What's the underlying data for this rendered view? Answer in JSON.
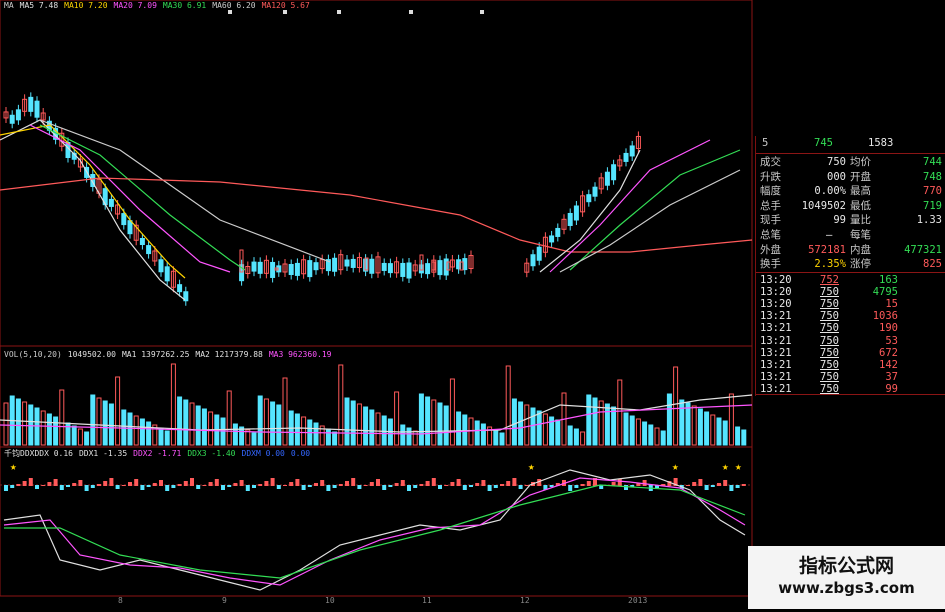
{
  "ma_legend": [
    {
      "text": "MA",
      "color": "#cccccc"
    },
    {
      "text": "MA5 7.48",
      "color": "#e0e0e0"
    },
    {
      "text": "MA10 7.20",
      "color": "#ffd400"
    },
    {
      "text": "MA20 7.09",
      "color": "#ff55ff"
    },
    {
      "text": "MA30 6.91",
      "color": "#33dd55"
    },
    {
      "text": "MA60 6.20",
      "color": "#cccccc"
    },
    {
      "text": "MA120 5.67",
      "color": "#ff5a5a"
    }
  ],
  "vol_legend": [
    {
      "text": "VOL(5,10,20)",
      "color": "#cccccc"
    },
    {
      "text": "1049502.00",
      "color": "#e0e0e0"
    },
    {
      "text": "MA1 1397262.25",
      "color": "#e0e0e0"
    },
    {
      "text": "MA2 1217379.88",
      "color": "#e0e0e0"
    },
    {
      "text": "MA3 962360.19",
      "color": "#ff55ff"
    }
  ],
  "ddx_legend": [
    {
      "text": "千钧DDXDDX 0.16",
      "color": "#e0e0e0"
    },
    {
      "text": "DDX1 -1.35",
      "color": "#e0e0e0"
    },
    {
      "text": "DDX2 -1.71",
      "color": "#ff55ff"
    },
    {
      "text": "DDX3 -1.40",
      "color": "#33dd55"
    },
    {
      "text": "DDXM 0.00",
      "color": "#3366ff"
    },
    {
      "text": "0.00",
      "color": "#3366ff"
    }
  ],
  "date_axis": [
    "8",
    "9",
    "10",
    "11",
    "12",
    "2013"
  ],
  "panel": {
    "header": {
      "label": "5",
      "v1": "745",
      "v2": "1583"
    },
    "stats": [
      {
        "k1": "成交",
        "v1": "750",
        "k2": "均价",
        "v2": "744",
        "c1": "w",
        "c2": "g"
      },
      {
        "k1": "升跌",
        "v1": "000",
        "k2": "开盘",
        "v2": "748",
        "c1": "w",
        "c2": "g"
      },
      {
        "k1": "幅度",
        "v1": "0.00%",
        "k2": "最高",
        "v2": "770",
        "c1": "w",
        "c2": "r"
      },
      {
        "k1": "总手",
        "v1": "1049502",
        "k2": "最低",
        "v2": "719",
        "c1": "w",
        "c2": "g"
      },
      {
        "k1": "现手",
        "v1": "99",
        "k2": "量比",
        "v2": "1.33",
        "c1": "w",
        "c2": "w"
      },
      {
        "k1": "总笔",
        "v1": "",
        "k2": "每笔",
        "v2": "",
        "c1": "w",
        "c2": "w"
      },
      {
        "k1": "外盘",
        "v1": "572181",
        "k2": "内盘",
        "v2": "477321",
        "c1": "r",
        "c2": "g"
      },
      {
        "k1": "换手",
        "v1": "2.35%",
        "k2": "涨停",
        "v2": "825",
        "c1": "y",
        "c2": "r"
      }
    ],
    "ticks": [
      {
        "time": "13:20",
        "price": "752",
        "vol": "163",
        "pc": "r",
        "vc": "g"
      },
      {
        "time": "13:20",
        "price": "750",
        "vol": "4795",
        "pc": "w",
        "vc": "g"
      },
      {
        "time": "13:20",
        "price": "750",
        "vol": "15",
        "pc": "w",
        "vc": "r"
      },
      {
        "time": "13:21",
        "price": "750",
        "vol": "1036",
        "pc": "w",
        "vc": "r"
      },
      {
        "time": "13:21",
        "price": "750",
        "vol": "190",
        "pc": "w",
        "vc": "r"
      },
      {
        "time": "13:21",
        "price": "750",
        "vol": "53",
        "pc": "w",
        "vc": "r"
      },
      {
        "time": "13:21",
        "price": "750",
        "vol": "672",
        "pc": "w",
        "vc": "r"
      },
      {
        "time": "13:21",
        "price": "750",
        "vol": "142",
        "pc": "w",
        "vc": "r"
      },
      {
        "time": "13:21",
        "price": "750",
        "vol": "37",
        "pc": "w",
        "vc": "r"
      },
      {
        "time": "13:21",
        "price": "750",
        "vol": "99",
        "pc": "w",
        "vc": "r"
      }
    ]
  },
  "watermark": {
    "title": "指标公式网",
    "url": "www.zbgs3.com"
  },
  "colors": {
    "up": "#ff5a5a",
    "down": "#55e5ff",
    "ma5": "#e0e0e0",
    "ma10": "#ffd400",
    "ma20": "#ff55ff",
    "ma30": "#33dd55",
    "ma60": "#cccccc",
    "ma120": "#ff5a5a",
    "grid": "#8b1515"
  }
}
